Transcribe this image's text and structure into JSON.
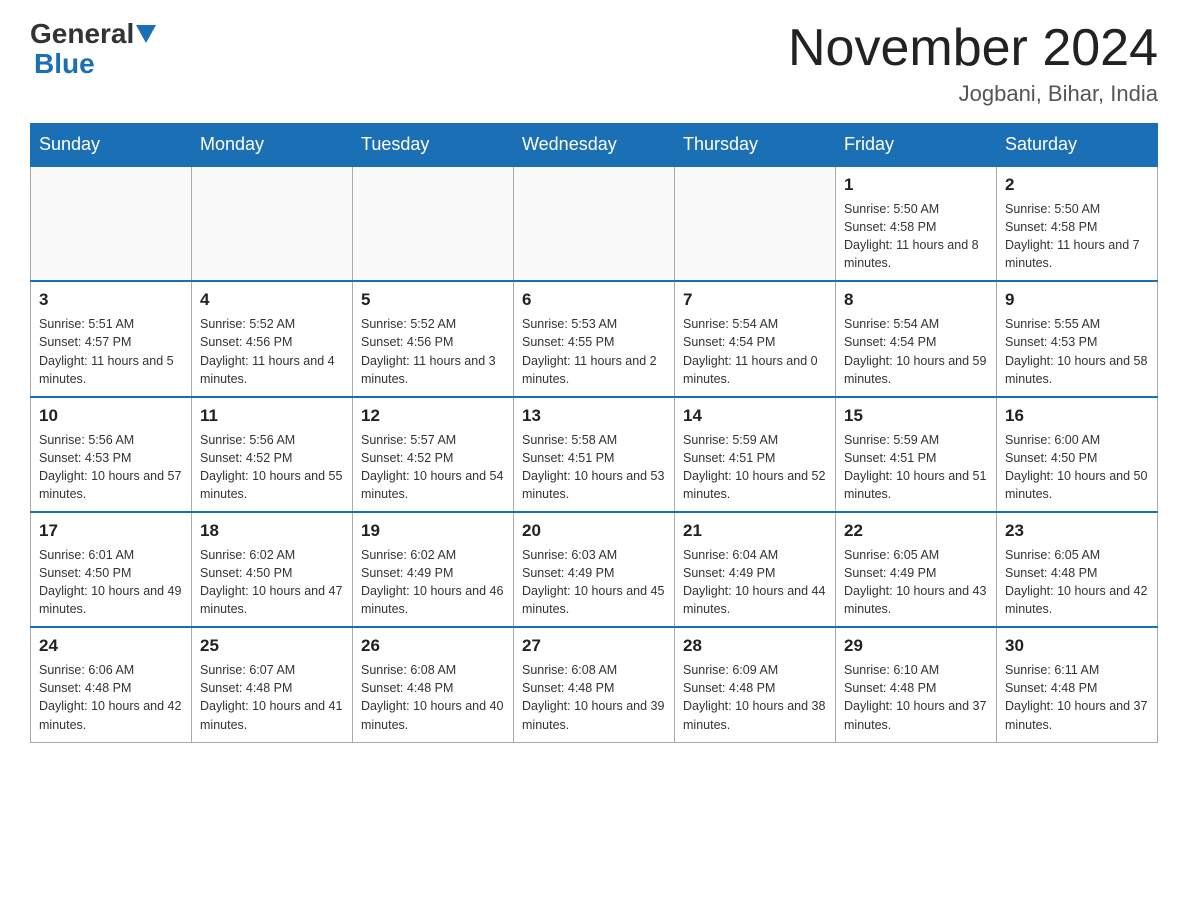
{
  "header": {
    "logo_general": "General",
    "logo_blue": "Blue",
    "month_title": "November 2024",
    "location": "Jogbani, Bihar, India"
  },
  "days_of_week": [
    "Sunday",
    "Monday",
    "Tuesday",
    "Wednesday",
    "Thursday",
    "Friday",
    "Saturday"
  ],
  "weeks": [
    [
      {
        "day": "",
        "info": ""
      },
      {
        "day": "",
        "info": ""
      },
      {
        "day": "",
        "info": ""
      },
      {
        "day": "",
        "info": ""
      },
      {
        "day": "",
        "info": ""
      },
      {
        "day": "1",
        "info": "Sunrise: 5:50 AM\nSunset: 4:58 PM\nDaylight: 11 hours and 8 minutes."
      },
      {
        "day": "2",
        "info": "Sunrise: 5:50 AM\nSunset: 4:58 PM\nDaylight: 11 hours and 7 minutes."
      }
    ],
    [
      {
        "day": "3",
        "info": "Sunrise: 5:51 AM\nSunset: 4:57 PM\nDaylight: 11 hours and 5 minutes."
      },
      {
        "day": "4",
        "info": "Sunrise: 5:52 AM\nSunset: 4:56 PM\nDaylight: 11 hours and 4 minutes."
      },
      {
        "day": "5",
        "info": "Sunrise: 5:52 AM\nSunset: 4:56 PM\nDaylight: 11 hours and 3 minutes."
      },
      {
        "day": "6",
        "info": "Sunrise: 5:53 AM\nSunset: 4:55 PM\nDaylight: 11 hours and 2 minutes."
      },
      {
        "day": "7",
        "info": "Sunrise: 5:54 AM\nSunset: 4:54 PM\nDaylight: 11 hours and 0 minutes."
      },
      {
        "day": "8",
        "info": "Sunrise: 5:54 AM\nSunset: 4:54 PM\nDaylight: 10 hours and 59 minutes."
      },
      {
        "day": "9",
        "info": "Sunrise: 5:55 AM\nSunset: 4:53 PM\nDaylight: 10 hours and 58 minutes."
      }
    ],
    [
      {
        "day": "10",
        "info": "Sunrise: 5:56 AM\nSunset: 4:53 PM\nDaylight: 10 hours and 57 minutes."
      },
      {
        "day": "11",
        "info": "Sunrise: 5:56 AM\nSunset: 4:52 PM\nDaylight: 10 hours and 55 minutes."
      },
      {
        "day": "12",
        "info": "Sunrise: 5:57 AM\nSunset: 4:52 PM\nDaylight: 10 hours and 54 minutes."
      },
      {
        "day": "13",
        "info": "Sunrise: 5:58 AM\nSunset: 4:51 PM\nDaylight: 10 hours and 53 minutes."
      },
      {
        "day": "14",
        "info": "Sunrise: 5:59 AM\nSunset: 4:51 PM\nDaylight: 10 hours and 52 minutes."
      },
      {
        "day": "15",
        "info": "Sunrise: 5:59 AM\nSunset: 4:51 PM\nDaylight: 10 hours and 51 minutes."
      },
      {
        "day": "16",
        "info": "Sunrise: 6:00 AM\nSunset: 4:50 PM\nDaylight: 10 hours and 50 minutes."
      }
    ],
    [
      {
        "day": "17",
        "info": "Sunrise: 6:01 AM\nSunset: 4:50 PM\nDaylight: 10 hours and 49 minutes."
      },
      {
        "day": "18",
        "info": "Sunrise: 6:02 AM\nSunset: 4:50 PM\nDaylight: 10 hours and 47 minutes."
      },
      {
        "day": "19",
        "info": "Sunrise: 6:02 AM\nSunset: 4:49 PM\nDaylight: 10 hours and 46 minutes."
      },
      {
        "day": "20",
        "info": "Sunrise: 6:03 AM\nSunset: 4:49 PM\nDaylight: 10 hours and 45 minutes."
      },
      {
        "day": "21",
        "info": "Sunrise: 6:04 AM\nSunset: 4:49 PM\nDaylight: 10 hours and 44 minutes."
      },
      {
        "day": "22",
        "info": "Sunrise: 6:05 AM\nSunset: 4:49 PM\nDaylight: 10 hours and 43 minutes."
      },
      {
        "day": "23",
        "info": "Sunrise: 6:05 AM\nSunset: 4:48 PM\nDaylight: 10 hours and 42 minutes."
      }
    ],
    [
      {
        "day": "24",
        "info": "Sunrise: 6:06 AM\nSunset: 4:48 PM\nDaylight: 10 hours and 42 minutes."
      },
      {
        "day": "25",
        "info": "Sunrise: 6:07 AM\nSunset: 4:48 PM\nDaylight: 10 hours and 41 minutes."
      },
      {
        "day": "26",
        "info": "Sunrise: 6:08 AM\nSunset: 4:48 PM\nDaylight: 10 hours and 40 minutes."
      },
      {
        "day": "27",
        "info": "Sunrise: 6:08 AM\nSunset: 4:48 PM\nDaylight: 10 hours and 39 minutes."
      },
      {
        "day": "28",
        "info": "Sunrise: 6:09 AM\nSunset: 4:48 PM\nDaylight: 10 hours and 38 minutes."
      },
      {
        "day": "29",
        "info": "Sunrise: 6:10 AM\nSunset: 4:48 PM\nDaylight: 10 hours and 37 minutes."
      },
      {
        "day": "30",
        "info": "Sunrise: 6:11 AM\nSunset: 4:48 PM\nDaylight: 10 hours and 37 minutes."
      }
    ]
  ]
}
